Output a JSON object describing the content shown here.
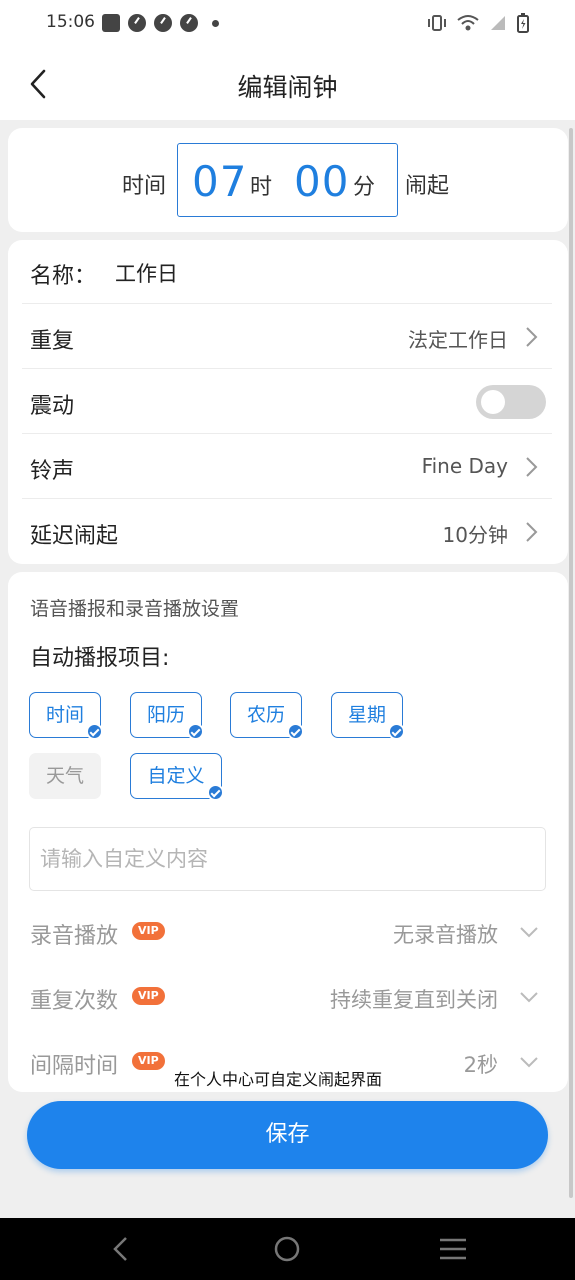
{
  "status_bar": {
    "time": "15:06"
  },
  "header": {
    "title": "编辑闹钟"
  },
  "time_picker": {
    "prefix": "时间",
    "hour": "07",
    "hour_unit": "时",
    "minute": "00",
    "minute_unit": "分",
    "suffix": "闹起"
  },
  "settings": {
    "name_label": "名称：",
    "name_value": "工作日",
    "repeat_label": "重复",
    "repeat_value": "法定工作日",
    "vibrate_label": "震动",
    "vibrate_on": false,
    "ringtone_label": "铃声",
    "ringtone_value": "Fine Day",
    "snooze_label": "延迟闹起",
    "snooze_value": "10分钟"
  },
  "voice": {
    "section_title": "语音播报和录音播放设置",
    "auto_title": "自动播报项目:",
    "chips": [
      {
        "label": "时间",
        "selected": true
      },
      {
        "label": "阳历",
        "selected": true
      },
      {
        "label": "农历",
        "selected": true
      },
      {
        "label": "星期",
        "selected": true
      },
      {
        "label": "天气",
        "selected": false
      },
      {
        "label": "自定义",
        "selected": true
      }
    ],
    "custom_placeholder": "请输入自定义内容",
    "vip_badge": "VIP",
    "recording_label": "录音播放",
    "recording_value": "无录音播放",
    "repeat_count_label": "重复次数",
    "repeat_count_value": "持续重复直到关闭",
    "interval_label": "间隔时间",
    "interval_value": "2秒"
  },
  "hint": "在个人中心可自定义闹起界面",
  "save_label": "保存",
  "colors": {
    "accent": "#1e83ec",
    "vip": "#f2713a"
  }
}
